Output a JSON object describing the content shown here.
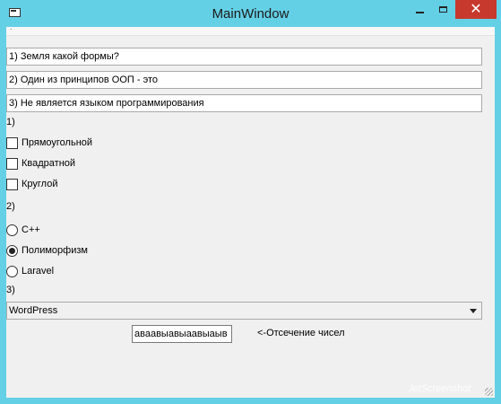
{
  "window": {
    "title": "MainWindow"
  },
  "titlebar_buttons": {
    "close_glyph": "✕"
  },
  "menubar": {
    "text": "."
  },
  "questions": {
    "q1": "1) Земля какой формы?",
    "q2": "2) Один из принципов ООП - это",
    "q3": "3) Не является языком программирования"
  },
  "section1": {
    "label": "1)",
    "options": [
      {
        "label": "Прямоугольной",
        "checked": false
      },
      {
        "label": "Квадратной",
        "checked": false
      },
      {
        "label": "Круглой",
        "checked": false
      }
    ]
  },
  "section2": {
    "label": "2)",
    "options": [
      {
        "label": "C++",
        "selected": false
      },
      {
        "label": "Полиморфизм",
        "selected": true
      },
      {
        "label": "Laravel",
        "selected": false
      }
    ]
  },
  "section3": {
    "label": "3)",
    "combo_value": "WordPress"
  },
  "truncate": {
    "input_value": "аваавыавыаавыаыв",
    "label": "<-Отсечение чисел"
  },
  "watermark": {
    "text": "JetScreenshot"
  },
  "colors": {
    "titlebar": "#64d0e6",
    "close": "#c7392d",
    "client": "#f0f0f0"
  },
  "icons": [
    "app-icon",
    "minimize-icon",
    "maximize-icon",
    "close-icon",
    "dropdown-arrow-icon",
    "size-grip-icon"
  ]
}
